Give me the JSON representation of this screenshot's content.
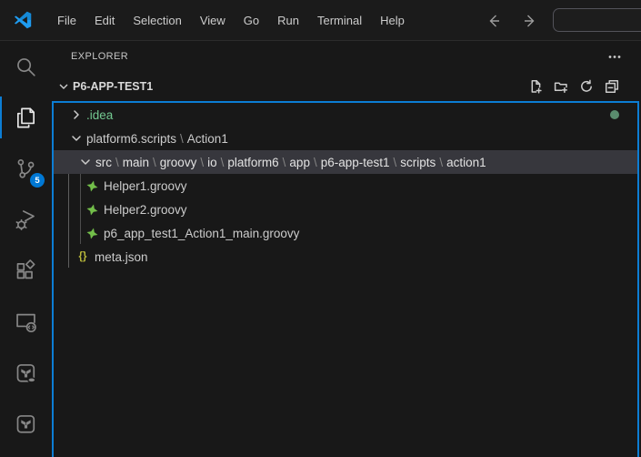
{
  "title_bar": {
    "menus": [
      "File",
      "Edit",
      "Selection",
      "View",
      "Go",
      "Run",
      "Terminal",
      "Help"
    ],
    "nav": {
      "back": "arrow-left-icon",
      "forward": "arrow-right-icon"
    },
    "command_center": {
      "value": "",
      "placeholder": ""
    }
  },
  "activity_bar": {
    "items": [
      {
        "id": "search",
        "icon": "search",
        "active": false
      },
      {
        "id": "explorer",
        "icon": "files",
        "active": true
      },
      {
        "id": "source-control",
        "icon": "source-control",
        "active": false,
        "badge": "5"
      },
      {
        "id": "run-debug",
        "icon": "debug",
        "active": false
      },
      {
        "id": "extensions",
        "icon": "extensions",
        "active": false
      },
      {
        "id": "remote-explorer",
        "icon": "remote",
        "active": false
      },
      {
        "id": "platform6-tests",
        "icon": "platform-cloud",
        "active": false
      },
      {
        "id": "platform6",
        "icon": "platform",
        "active": false
      }
    ]
  },
  "sidebar": {
    "title": "EXPLORER",
    "section": {
      "name": "P6-APP-TEST1",
      "expanded": true
    },
    "section_actions": [
      {
        "id": "new-file",
        "icon": "new-file"
      },
      {
        "id": "new-folder",
        "icon": "new-folder"
      },
      {
        "id": "refresh",
        "icon": "refresh"
      },
      {
        "id": "collapse-all",
        "icon": "collapse-all"
      }
    ],
    "tree": {
      "separator": "\\",
      "rows": [
        {
          "id": "idea",
          "kind": "folder",
          "indent": 0,
          "expanded": false,
          "parts": [
            ".idea"
          ],
          "text_color": "#73c991",
          "badge": "dot"
        },
        {
          "id": "platform6-scripts-action1",
          "kind": "folder",
          "indent": 0,
          "expanded": true,
          "parts": [
            "platform6.scripts",
            "Action1"
          ]
        },
        {
          "id": "src-main-groovy-io-platform6-app-p6-app-test1-scripts-action1",
          "kind": "folder",
          "indent": 1,
          "expanded": true,
          "selected": true,
          "parts": [
            "src",
            "main",
            "groovy",
            "io",
            "platform6",
            "app",
            "p6-app-test1",
            "scripts",
            "action1"
          ]
        },
        {
          "id": "helper1-groovy",
          "kind": "file",
          "indent": 2,
          "icon": "groovy",
          "parts": [
            "Helper1.groovy"
          ]
        },
        {
          "id": "helper2-groovy",
          "kind": "file",
          "indent": 2,
          "icon": "groovy",
          "parts": [
            "Helper2.groovy"
          ]
        },
        {
          "id": "p6-app-test1-action1-main-groovy",
          "kind": "file",
          "indent": 2,
          "icon": "groovy",
          "parts": [
            "p6_app_test1_Action1_main.groovy"
          ]
        },
        {
          "id": "meta-json",
          "kind": "file",
          "indent": 1,
          "icon": "json",
          "parts": [
            "meta.json"
          ]
        }
      ]
    }
  },
  "colors": {
    "focus_border": "#0c7dd4",
    "selection_background": "#37373d",
    "untracked_green": "#73c991",
    "groovy_green": "#73bf4a",
    "json_yellow": "#b7b73b",
    "badge_blue": "#0078d4"
  }
}
